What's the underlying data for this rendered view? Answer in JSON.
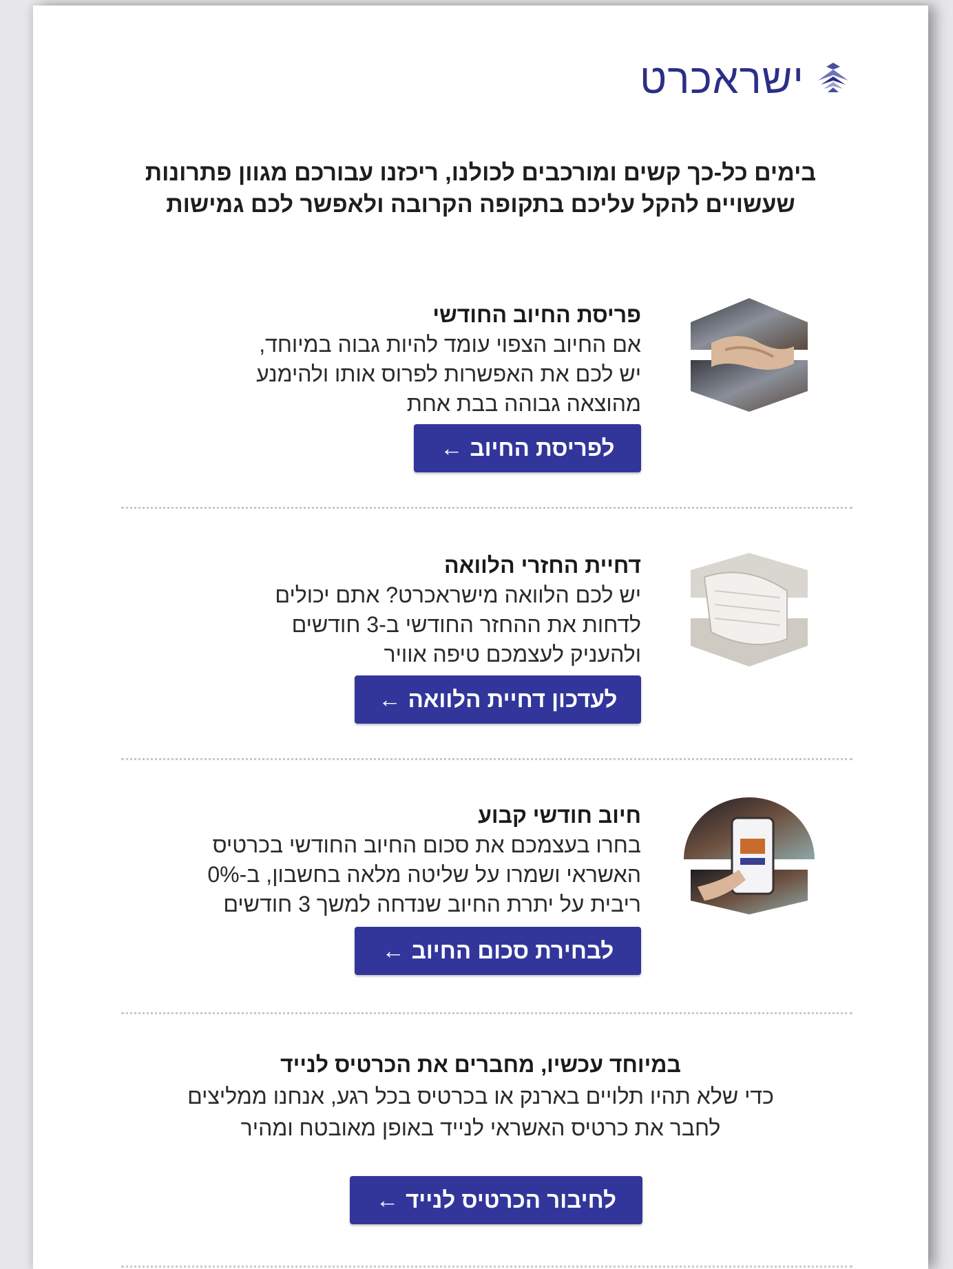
{
  "brand": {
    "name": "ישראכרט"
  },
  "intro": {
    "line1": "בימים כל-כך קשים ומורכבים לכולנו, ריכזנו עבורכם מגוון פתרונות",
    "line2": "שעשויים להקל עליכם בתקופה הקרובה ולאפשר לכם גמישות"
  },
  "sections": [
    {
      "title": "פריסת החיוב החודשי",
      "lines": [
        "אם החיוב הצפוי עומד להיות גבוה במיוחד,",
        "יש לכם את האפשרות לפרוס אותו ולהימנע",
        "מהוצאה גבוהה בבת אחת"
      ],
      "button": "לפריסת החיוב",
      "image_icon": "handshake-image"
    },
    {
      "title": "דחיית החזרי הלוואה",
      "lines": [
        "יש לכם הלוואה מישראכרט? אתם יכולים",
        "לדחות את ההחזר החודשי ב-3 חודשים",
        "ולהעניק לעצמכם טיפה אוויר"
      ],
      "button": "לעדכון דחיית הלוואה",
      "image_icon": "papers-image"
    },
    {
      "title": "חיוב חודשי קבוע",
      "lines": [
        "בחרו בעצמכם את סכום החיוב החודשי בכרטיס",
        "האשראי ושמרו על שליטה מלאה בחשבון, ב-0%",
        "ריבית על יתרת החיוב שנדחה למשך 3 חודשים"
      ],
      "button": "לבחירת סכום החיוב",
      "image_icon": "phone-payment-image"
    }
  ],
  "mobile": {
    "title": "במיוחד עכשיו, מחברים את הכרטיס לנייד",
    "line1": "כדי שלא תהיו תלויים בארנק או בכרטיס בכל רגע, אנחנו ממליצים",
    "line2": "לחבר את כרטיס האשראי לנייד באופן מאובטח ומהיר",
    "button": "לחיבור הכרטיס לנייד"
  },
  "arrow_icon": "arrow-left-icon",
  "colors": {
    "brand": "#2b2f86",
    "button": "#32369b"
  }
}
